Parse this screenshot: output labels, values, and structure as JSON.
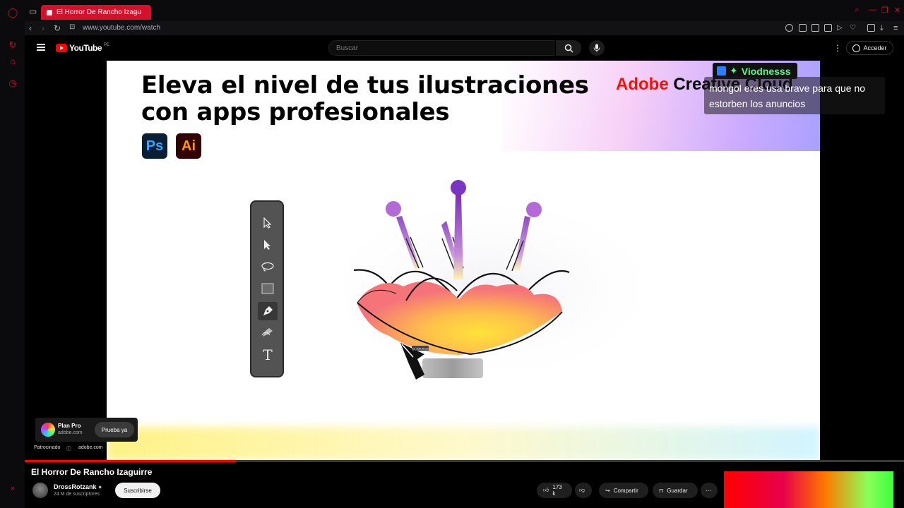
{
  "browser": {
    "tab_title": "El Horror De Rancho Izagu",
    "new_tab": "+",
    "url": "www.youtube.com/watch"
  },
  "youtube": {
    "logo_text": "YouTube",
    "logo_region": "PE",
    "search_placeholder": "Buscar",
    "sign_in": "Acceder"
  },
  "ad": {
    "headline_1": "Eleva el nivel de tus ilustraciones",
    "headline_2": "con apps profesionales",
    "ps_label": "Ps",
    "ai_label": "Ai",
    "brand_red": "Adobe",
    "brand_black": "Creative Cloud",
    "measure_label": "D: 100.00 px",
    "promo_title": "Plan Pro",
    "promo_domain": "adobe.com",
    "promo_cta": "Prueba ya",
    "sponsored": "Patrocinado",
    "sponsor_domain": "adobe.com",
    "progress_percent": 24
  },
  "overlay": {
    "extension_name": "Viodnesss",
    "caption": "mongol eres usa brave para que no estorben los anuncios"
  },
  "video": {
    "title": "El Horror De Rancho Izaguirre",
    "channel": "DrossRotzank",
    "subscribers": "24 M de suscriptores",
    "subscribe": "Suscribirse",
    "likes": "173 k",
    "share": "Compartir",
    "save": "Guardar"
  },
  "colors": {
    "browser_accent": "#d4102a",
    "youtube_red": "#ff0000",
    "viodness_green": "#4dff8a"
  }
}
